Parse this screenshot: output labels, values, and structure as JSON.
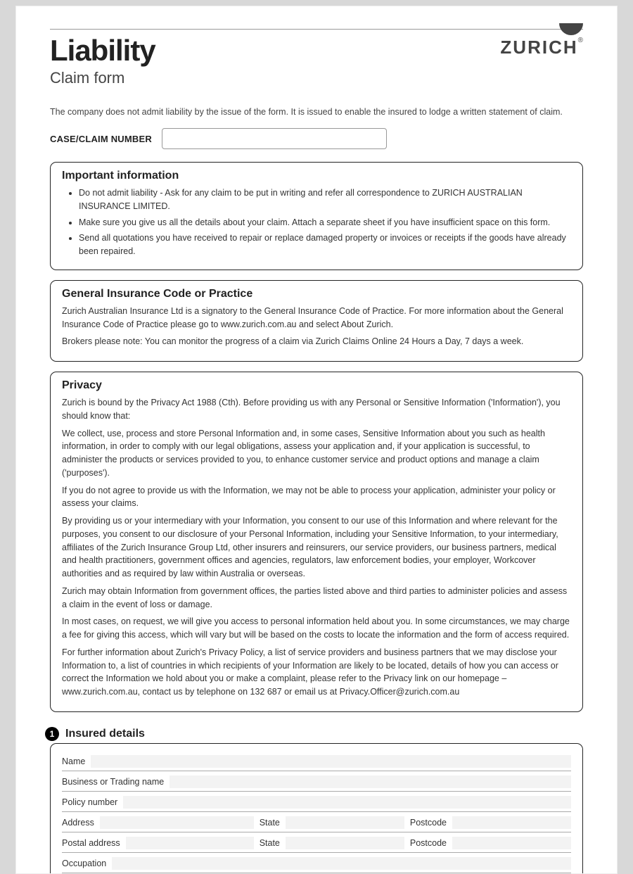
{
  "header": {
    "title": "Liability",
    "subtitle": "Claim form",
    "brand": "ZURICH",
    "reg": "®"
  },
  "intro": "The company does not admit liability by the issue of the form. It is issued to enable the insured to lodge a written statement of claim.",
  "case_label": "CASE/CLAIM NUMBER",
  "important": {
    "heading": "Important information",
    "items": [
      "Do not admit liability - Ask for any claim to be put in writing and refer all correspondence to ZURICH AUSTRALIAN INSURANCE LIMITED.",
      "Make sure you give us all the details about your claim. Attach a separate sheet if you have insufficient space on this form.",
      "Send all quotations you have received to repair or replace damaged property or invoices or receipts if the goods have already been repaired."
    ]
  },
  "code": {
    "heading": "General Insurance Code or Practice",
    "p1": "Zurich Australian Insurance Ltd is a signatory to the General Insurance Code of Practice. For more information about the General Insurance Code of Practice please go to www.zurich.com.au and select About Zurich.",
    "p2": "Brokers please note: You can monitor the progress of a claim via Zurich Claims Online 24 Hours a Day, 7 days a week."
  },
  "privacy": {
    "heading": "Privacy",
    "p1": "Zurich is bound by the Privacy Act 1988 (Cth). Before providing us with any Personal or Sensitive Information ('Information'), you should know that:",
    "p2": "We collect, use, process and store Personal Information and, in some cases, Sensitive Information about you such as health information, in order to comply with our legal obligations, assess your application and, if your application is successful, to administer the products or services provided to you, to enhance customer service and product options and manage a claim ('purposes').",
    "p3": "If you do not agree to provide us with the Information, we may not be able to process your application, administer your policy or assess your claims.",
    "p4": "By providing us or your intermediary with your Information, you consent to our use of this Information and where relevant for the purposes, you consent to our disclosure of your Personal Information, including your Sensitive Information, to your intermediary, affiliates of the Zurich Insurance Group Ltd, other insurers and reinsurers, our service providers, our business partners, medical and health practitioners, government offices and agencies, regulators, law enforcement bodies, your employer, Workcover authorities and as required by law within Australia or overseas.",
    "p5": "Zurich may obtain Information from government offices, the parties listed above and third parties to administer policies and assess a claim in the event of loss or damage.",
    "p6": "In most cases, on request, we will give you access to personal information held about you. In some circumstances, we may charge a fee for giving this access, which will vary but will be based on the costs to locate the information and the form of access required.",
    "p7": "For further information about Zurich's Privacy Policy, a list of service providers and business partners that we may disclose your Information to, a list of countries in which recipients of your Information are likely to be located, details of how you can access or correct the Information we hold about you or make a complaint, please refer to the Privacy link on our homepage – www.zurich.com.au, contact us by telephone on 132 687 or email us at Privacy.Officer@zurich.com.au"
  },
  "section1": {
    "num": "1",
    "heading": "Insured details",
    "labels": {
      "name": "Name",
      "business": "Business or Trading name",
      "policy": "Policy number",
      "address": "Address",
      "state": "State",
      "postcode": "Postcode",
      "postal": "Postal address",
      "occupation": "Occupation"
    }
  }
}
